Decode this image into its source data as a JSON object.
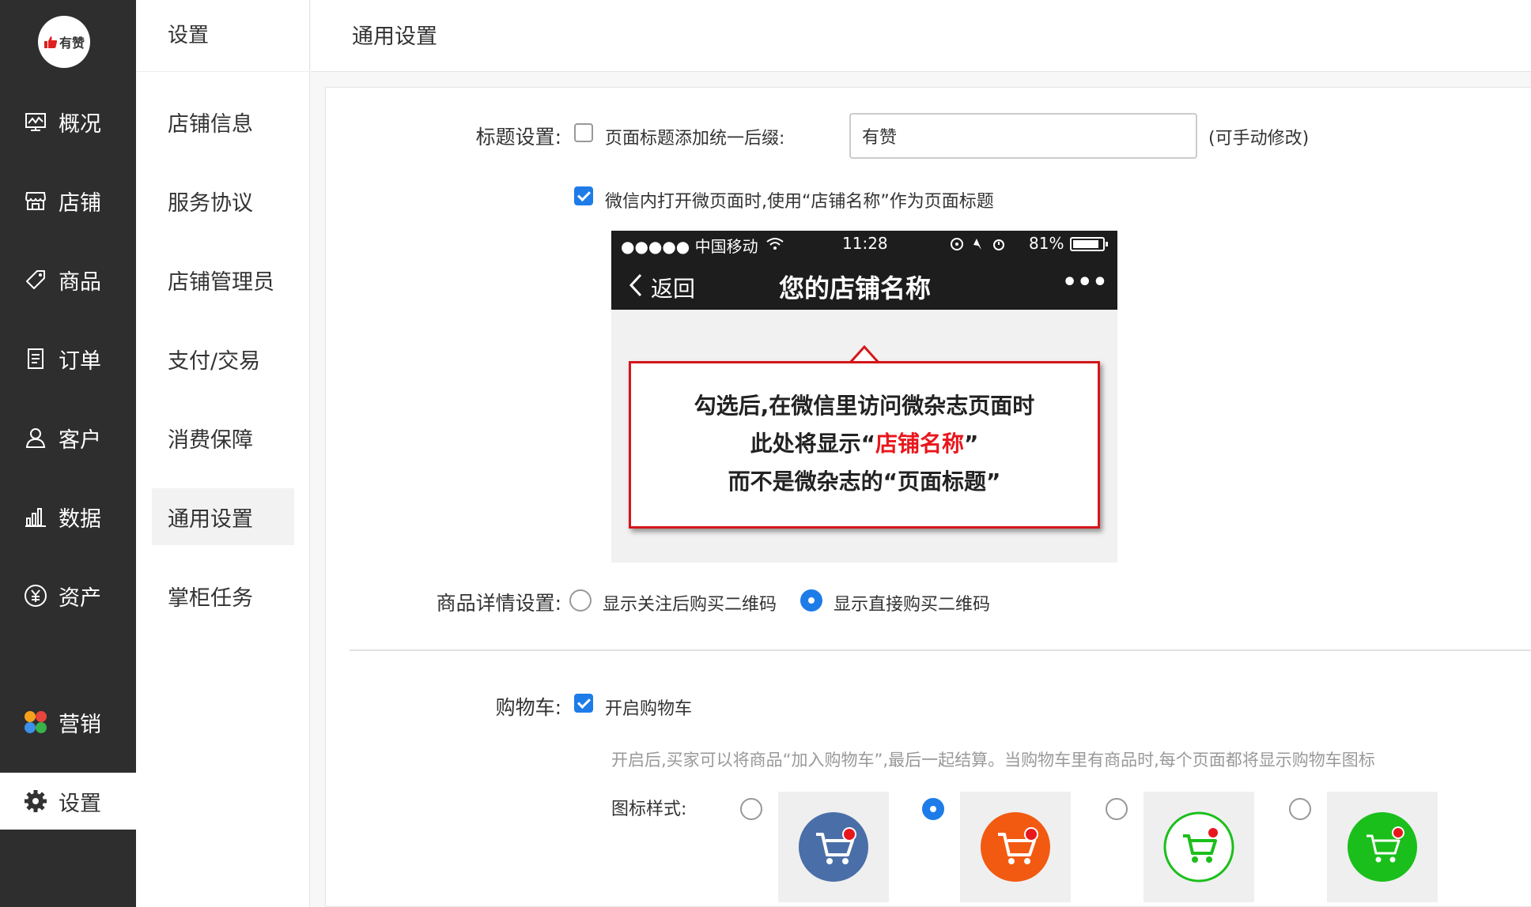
{
  "logo": {
    "text": "有赞"
  },
  "sidebar": {
    "items": [
      {
        "label": "概况",
        "icon": "chart-icon"
      },
      {
        "label": "店铺",
        "icon": "store-icon"
      },
      {
        "label": "商品",
        "icon": "tag-icon"
      },
      {
        "label": "订单",
        "icon": "order-icon"
      },
      {
        "label": "客户",
        "icon": "user-icon"
      },
      {
        "label": "数据",
        "icon": "bar-chart-icon"
      },
      {
        "label": "资产",
        "icon": "yuan-icon"
      },
      {
        "label": "营销",
        "icon": "marketing-icon"
      },
      {
        "label": "设置",
        "icon": "gear-icon"
      }
    ]
  },
  "subnav": {
    "title": "设置",
    "items": [
      {
        "label": "店铺信息"
      },
      {
        "label": "服务协议"
      },
      {
        "label": "店铺管理员"
      },
      {
        "label": "支付/交易"
      },
      {
        "label": "消费保障"
      },
      {
        "label": "通用设置"
      },
      {
        "label": "掌柜任务"
      }
    ]
  },
  "header": {
    "title": "通用设置"
  },
  "title_settings": {
    "label": "标题设置:",
    "suffix_checkbox_label": "页面标题添加统一后缀:",
    "suffix_value": "有赞",
    "suffix_note": "(可手动修改)",
    "wechat_checkbox_label": "微信内打开微页面时,使用“店铺名称”作为页面标题"
  },
  "preview": {
    "carrier": "●●●●● 中国移动",
    "time": "11:28",
    "battery": "81%",
    "back_label": "返回",
    "nav_title": "您的店铺名称",
    "more": "•••",
    "callout_line1": "勾选后,在微信里访问微杂志页面时",
    "callout_line2_pre": "此处将显示“",
    "callout_line2_red": "店铺名称",
    "callout_line2_post": "”",
    "callout_line3": "而不是微杂志的“页面标题”"
  },
  "detail_settings": {
    "label": "商品详情设置:",
    "option1": "显示关注后购买二维码",
    "option2": "显示直接购买二维码"
  },
  "cart": {
    "label": "购物车:",
    "checkbox_label": "开启购物车",
    "hint": "开启后,买家可以将商品“加入购物车”,最后一起结算。当购物车里有商品时,每个页面都将显示购物车图标",
    "icon_style_label": "图标样式:"
  },
  "colors": {
    "accent": "#1e7ce8",
    "cart_blue": "#4a6ea8",
    "cart_orange": "#f25a12",
    "cart_green": "#1bbf1b",
    "callout_red": "#d4161b"
  }
}
